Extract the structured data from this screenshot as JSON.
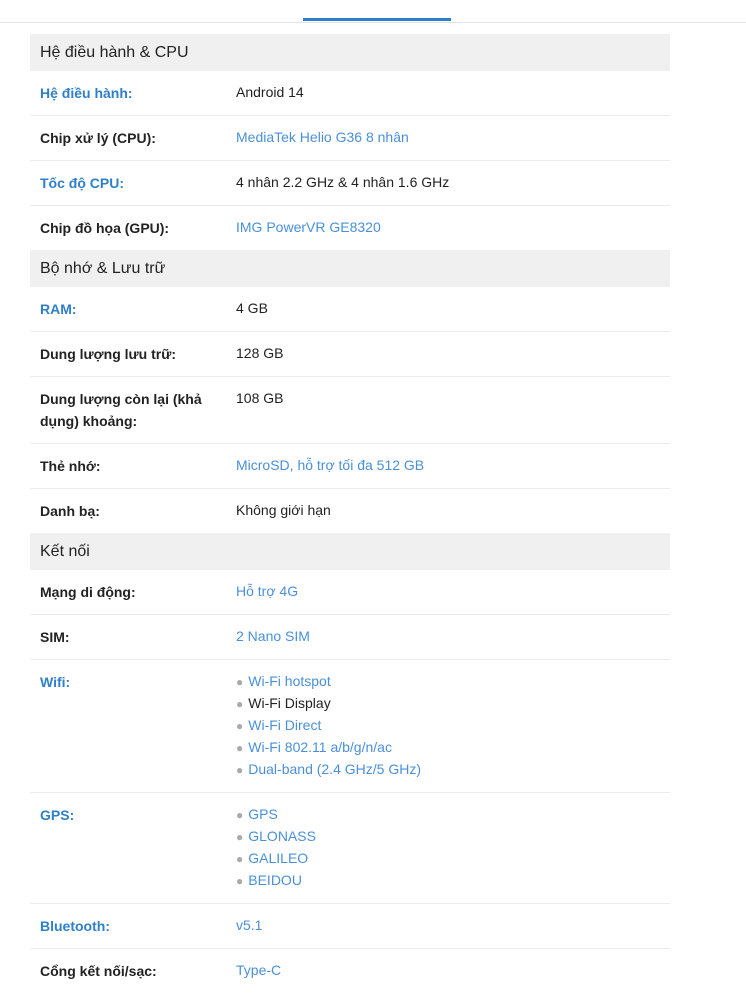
{
  "sections": [
    {
      "title": "Hệ điều hành & CPU",
      "rows": [
        {
          "label": "Hệ điều hành:",
          "value": "Android 14"
        },
        {
          "label": "Chip xử lý (CPU):",
          "value": "MediaTek Helio G36 8 nhân"
        },
        {
          "label": "Tốc độ CPU:",
          "value": "4 nhân 2.2 GHz & 4 nhân 1.6 GHz"
        },
        {
          "label": "Chip đồ họa (GPU):",
          "value": "IMG PowerVR GE8320"
        }
      ]
    },
    {
      "title": "Bộ nhớ & Lưu trữ",
      "rows": [
        {
          "label": "RAM:",
          "value": "4 GB"
        },
        {
          "label": "Dung lượng lưu trữ:",
          "value": "128 GB"
        },
        {
          "label": "Dung lượng còn lại (khả dụng) khoảng:",
          "value": "108 GB"
        },
        {
          "label": "Thẻ nhớ:",
          "value": "MicroSD, hỗ trợ tối đa 512 GB"
        },
        {
          "label": "Danh bạ:",
          "value": "Không giới hạn"
        }
      ]
    },
    {
      "title": "Kết nối",
      "rows": [
        {
          "label": "Mạng di động:",
          "value": "Hỗ trợ 4G"
        },
        {
          "label": "SIM:",
          "value": "2 Nano SIM"
        },
        {
          "label": "Wifi:",
          "items": [
            "Wi-Fi hotspot",
            "Wi-Fi Display",
            "Wi-Fi Direct",
            "Wi-Fi 802.11 a/b/g/n/ac",
            "Dual-band (2.4 GHz/5 GHz)"
          ]
        },
        {
          "label": "GPS:",
          "items": [
            "GPS",
            "GLONASS",
            "GALILEO",
            "BEIDOU"
          ]
        },
        {
          "label": "Bluetooth:",
          "value": "v5.1"
        },
        {
          "label": "Cổng kết nối/sạc:",
          "value": "Type-C"
        }
      ]
    }
  ],
  "colors": {
    "link": "#4a90d9",
    "label_link": "#2f80c8",
    "section_bg": "#f0f0f0",
    "tab_indicator": "#2f80c8"
  }
}
